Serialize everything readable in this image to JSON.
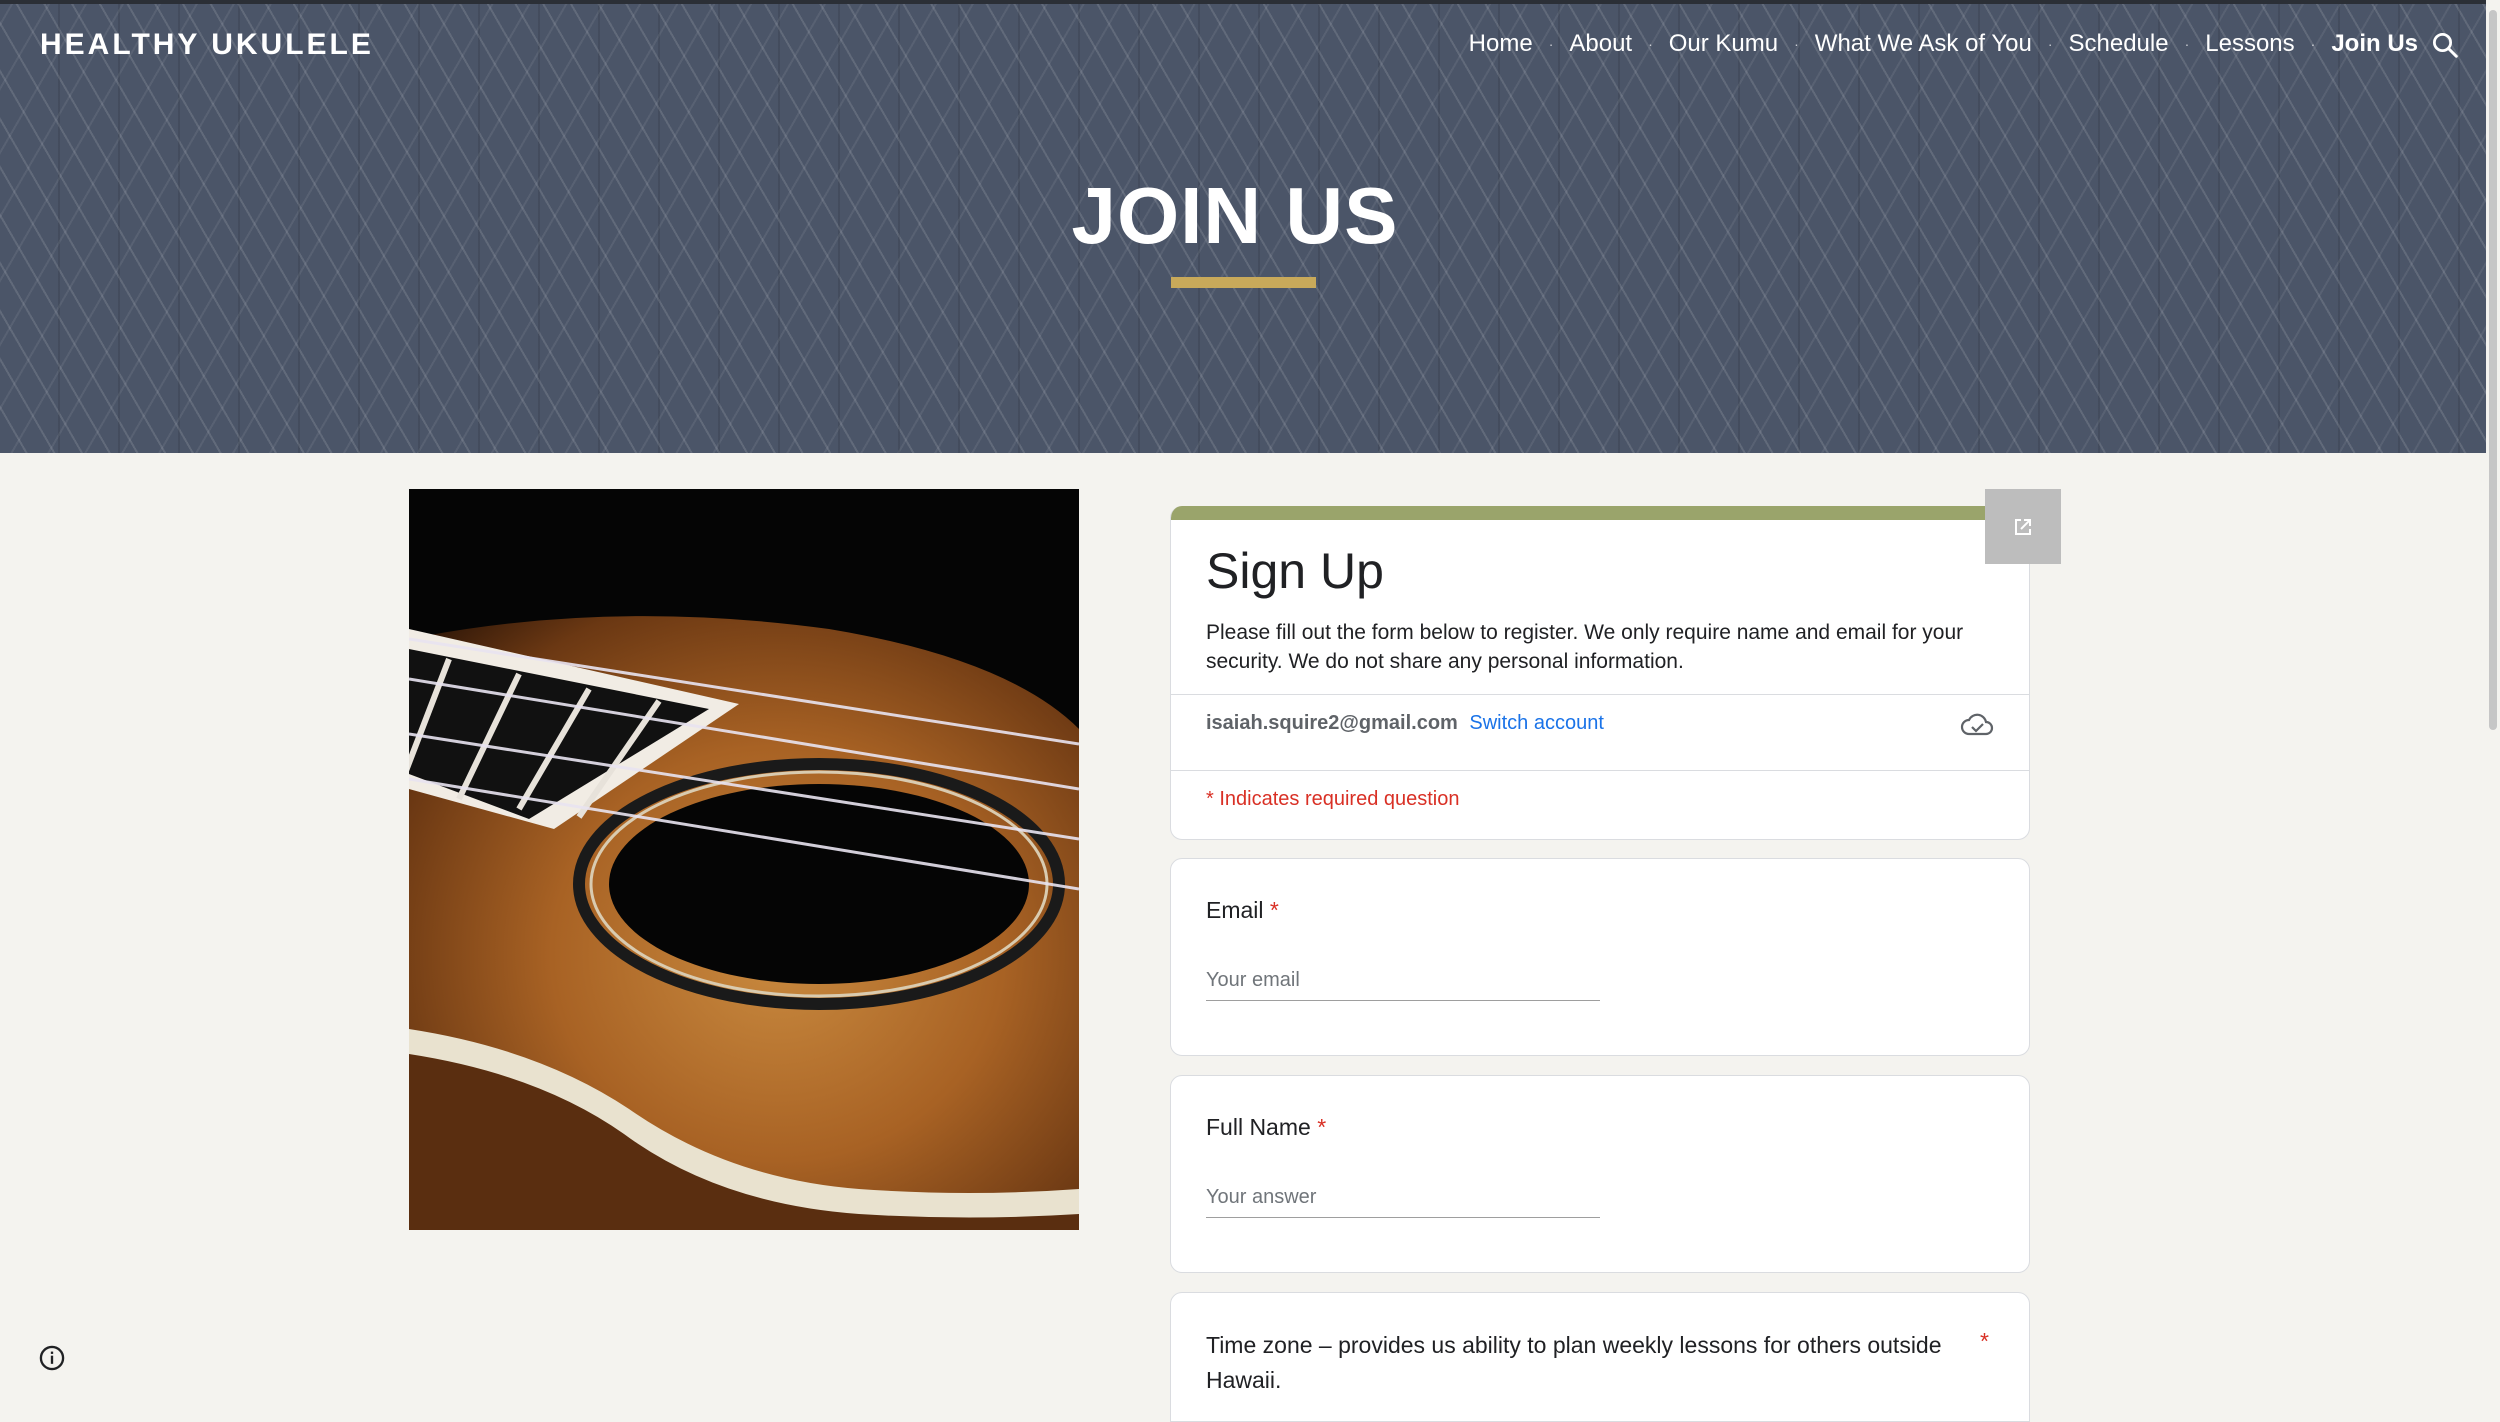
{
  "site": {
    "title": "HEALTHY UKULELE"
  },
  "nav": {
    "items": [
      {
        "label": "Home"
      },
      {
        "label": "About"
      },
      {
        "label": "Our Kumu"
      },
      {
        "label": "What We Ask of You"
      },
      {
        "label": "Schedule"
      },
      {
        "label": "Lessons"
      },
      {
        "label": "Join Us",
        "active": true
      }
    ],
    "search_icon": "search-icon"
  },
  "hero": {
    "heading": "JOIN US",
    "accent_color": "#c8a95a"
  },
  "form": {
    "title": "Sign Up",
    "description": "Please fill out the form below to register. We only require name and email for your security. We do not share any personal information.",
    "account_email": "isaiah.squire2@gmail.com",
    "switch_account": "Switch account",
    "required_note": "* Indicates required question",
    "accent_color": "#9aa46b",
    "questions": [
      {
        "label": "Email",
        "required": "*",
        "placeholder": "Your email"
      },
      {
        "label": "Full Name",
        "required": "*",
        "placeholder": "Your answer"
      },
      {
        "label": "Time zone – provides us ability to plan weekly lessons for others outside Hawaii.",
        "required": "*"
      }
    ]
  },
  "icons": {
    "open_in_new": "open-in-new-icon",
    "cloud_saved": "cloud-done-icon",
    "info": "info-icon"
  }
}
